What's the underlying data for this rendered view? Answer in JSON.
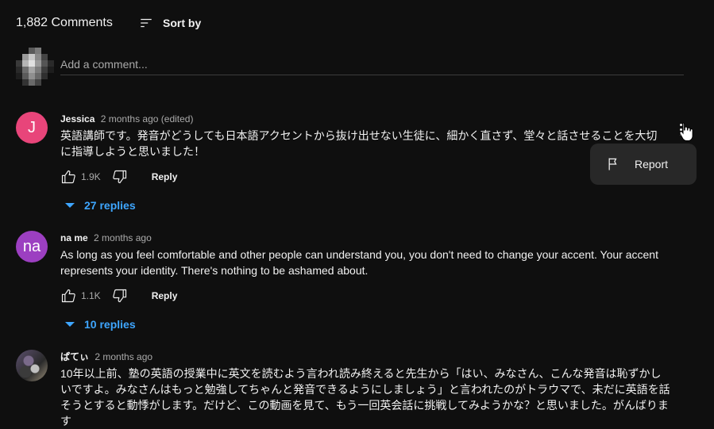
{
  "header": {
    "comment_count": "1,882 Comments",
    "sort_label": "Sort by"
  },
  "add_comment": {
    "placeholder": "Add a comment..."
  },
  "menu": {
    "report_label": "Report"
  },
  "comments": [
    {
      "author": "Jessica",
      "time": "2 months ago (edited)",
      "avatar_letter": "J",
      "avatar_color": "#e8457a",
      "text": "英語講師です。発音がどうしても日本語アクセントから抜け出せない生徒に、細かく直さず、堂々と話させることを大切に指導しようと思いました！",
      "likes": "1.9K",
      "reply_label": "Reply",
      "replies": "27 replies"
    },
    {
      "author": "na me",
      "time": "2 months ago",
      "avatar_letter": "na",
      "avatar_color": "#9c3fc1",
      "text": "As long as you feel comfortable and other people can understand you, you don't need to change your accent. Your accent represents your identity. There's nothing to be ashamed about.",
      "likes": "1.1K",
      "reply_label": "Reply",
      "replies": "10 replies"
    },
    {
      "author": "ぱてぃ",
      "time": "2 months ago",
      "text": "10年以上前、塾の英語の授業中に英文を読むよう言われ読み終えると先生から「はい、みなさん、こんな発音は恥ずかしいですよ。みなさんはもっと勉強してちゃんと発音できるようにしましょう」と言われたのがトラウマで、未だに英語を話そうとすると動悸がします。だけど、この動画を見て、もう一回英会話に挑戦してみようかな？と思いました。がんばります"
    }
  ]
}
